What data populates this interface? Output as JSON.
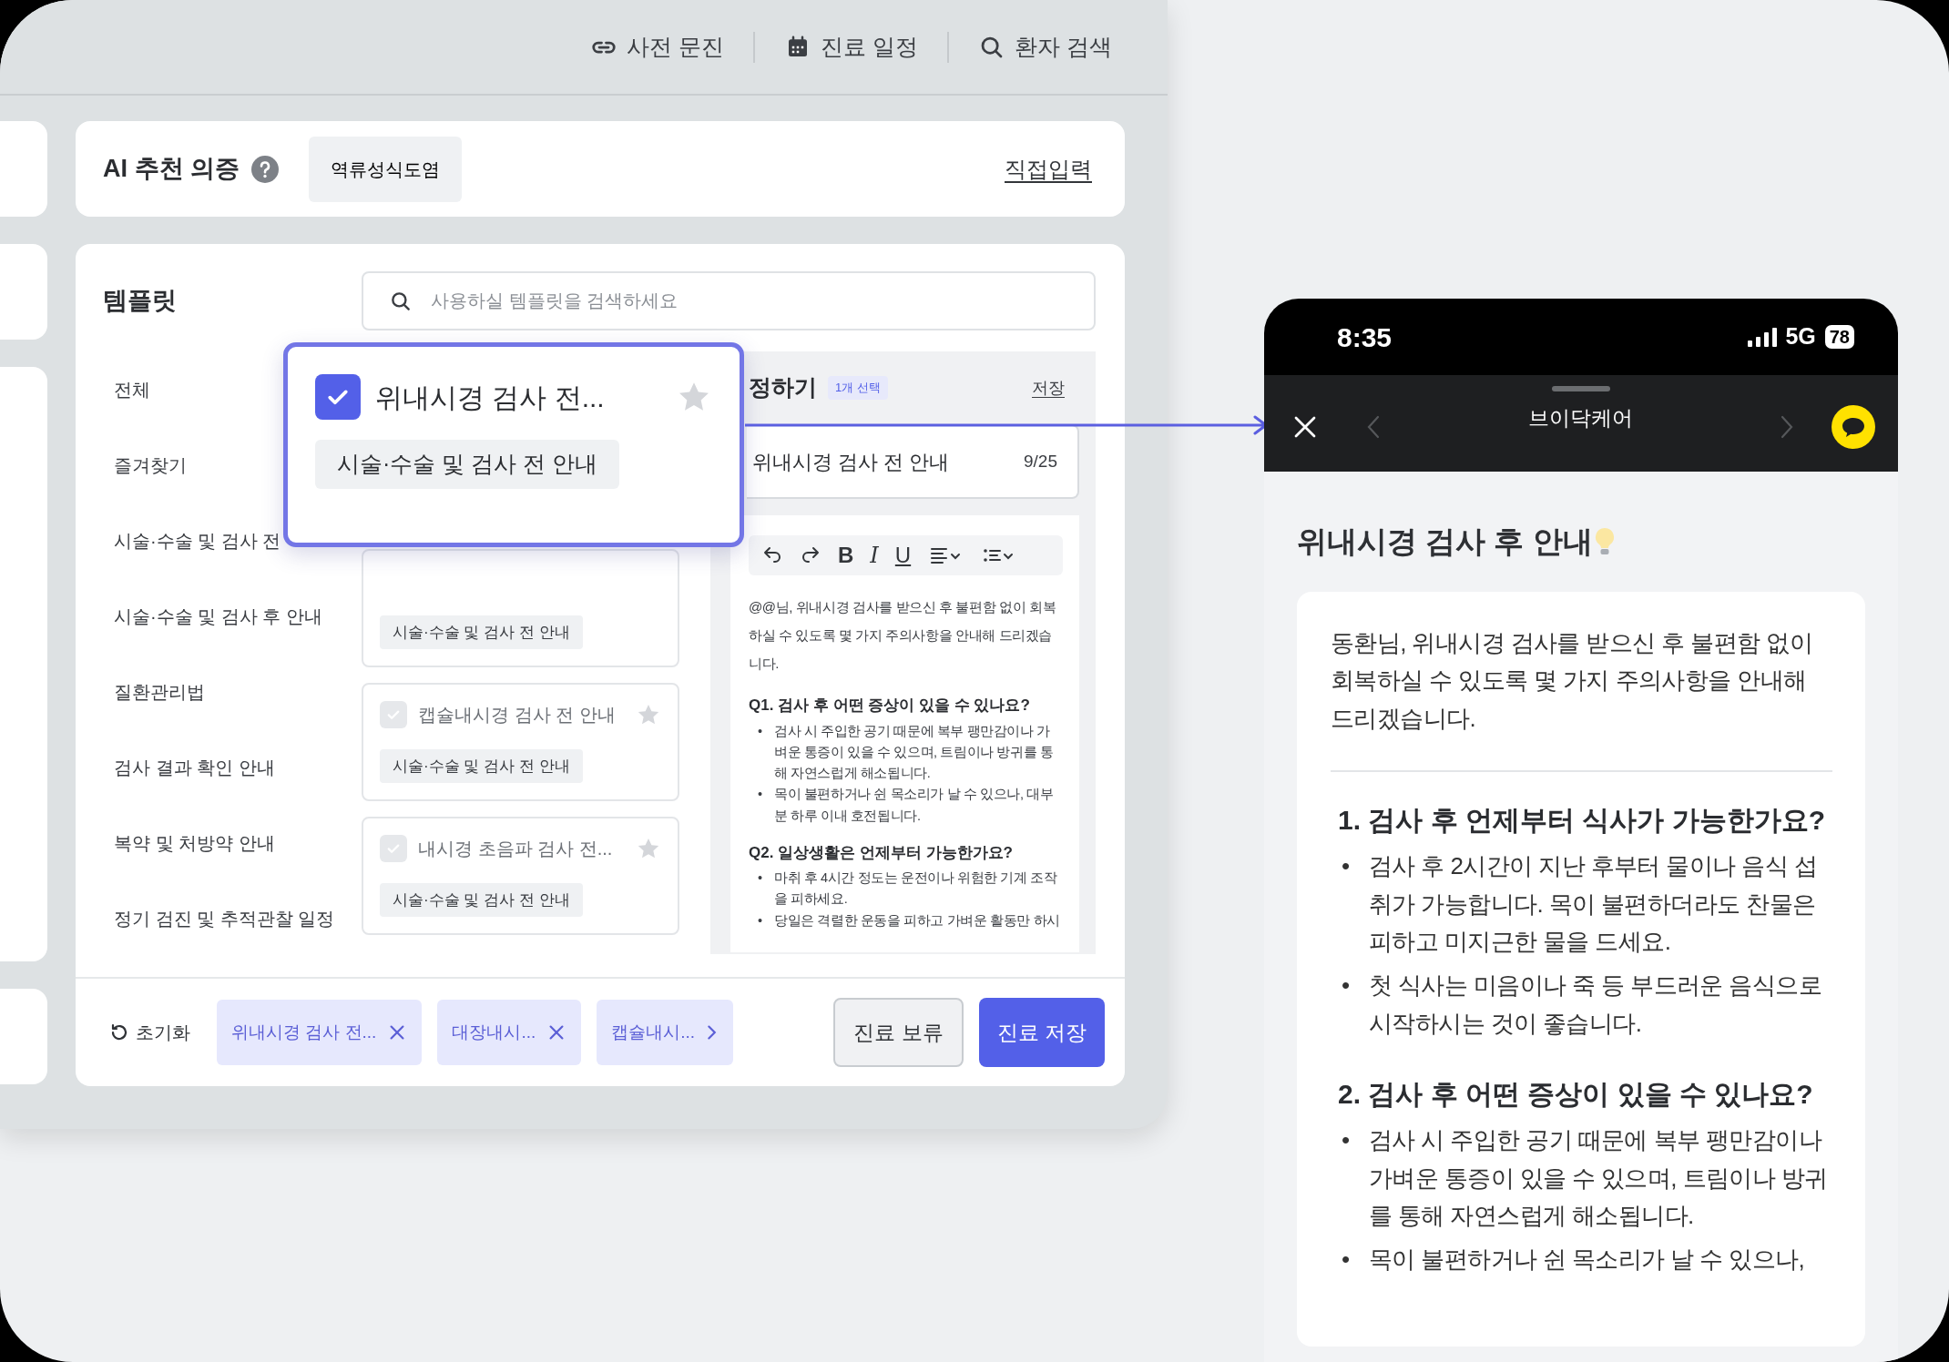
{
  "top_nav": [
    {
      "kind": "link",
      "label": "사전 문진"
    },
    {
      "kind": "calendar",
      "label": "진료 일정"
    },
    {
      "kind": "search",
      "label": "환자 검색"
    }
  ],
  "ai_diagnosis": {
    "title": "AI 추천 의증",
    "suggestions": [
      "역류성식도염"
    ],
    "manual_input": "직접입력"
  },
  "templates": {
    "title": "템플릿",
    "search": {
      "placeholder": "사용하실 템플릿을 검색하세요"
    },
    "categories": [
      "전체",
      "즐겨찾기",
      "시술·수술 및 검사 전",
      "시술·수술 및 검사 후 안내",
      "질환관리법",
      "검사 결과 확인 안내",
      "복약 및 처방약 안내",
      "정기 검진 및 추적관찰 일정"
    ],
    "items": [
      {
        "tag": "시술·수술 및 검사 전 안내"
      },
      {
        "title": "캡슐내시경 검사 전 안내",
        "checked": false,
        "starred": false,
        "tag": "시술·수술 및 검사 전 안내"
      },
      {
        "title": "내시경 초음파 검사 전...",
        "checked": false,
        "starred": false,
        "tag": "시술·수술 및 검사 전 안내"
      }
    ],
    "highlight": {
      "title": "위내시경 검사 전...",
      "checked": true,
      "starred": false,
      "tag": "시술·수술 및 검사 전 안내"
    }
  },
  "editor": {
    "heading": "정하기",
    "badge": "1개 선택",
    "save": "저장",
    "title_field": {
      "value": "위내시경 검사 전 안내",
      "counter": "9/25"
    },
    "toolbar": [
      {
        "kind": "undo"
      },
      {
        "kind": "redo"
      },
      {
        "kind": "bold",
        "label": "B"
      },
      {
        "kind": "italic",
        "label": "I"
      },
      {
        "kind": "underline",
        "label": "U"
      },
      {
        "kind": "align"
      },
      {
        "kind": "list"
      }
    ],
    "body": [
      {
        "kind": "paragraph",
        "text": "@@님, 위내시경 검사를 받으신 후 불편함 없이 회복하실 수 있도록 몇 가지 주의사항을 안내해 드리겠습니다."
      },
      {
        "kind": "heading",
        "text": "Q1. 검사 후 어떤 증상이 있을 수 있나요?"
      },
      {
        "kind": "bullets",
        "marker": "•",
        "items": [
          "검사 시 주입한 공기 때문에 복부 팽만감이나 가벼운 통증이 있을 수 있으며, 트림이나 방귀를 통해 자연스럽게 해소됩니다.",
          "목이 불편하거나 쉰 목소리가 날 수 있으나, 대부분 하루 이내 호전됩니다."
        ]
      },
      {
        "kind": "heading",
        "text": "Q2. 일상생활은 언제부터 가능한가요?"
      },
      {
        "kind": "bullets",
        "marker": "•",
        "items": [
          "마취 후 4시간 정도는 운전이나 위험한 기계 조작을 피하세요.",
          "당일은 격렬한 운동을 피하고 가벼운 활동만 하시"
        ]
      }
    ]
  },
  "bottom_bar": {
    "reset": "초기화",
    "chips": [
      {
        "kind": "removable",
        "label": "위내시경 검사 전..."
      },
      {
        "kind": "removable",
        "label": "대장내시..."
      },
      {
        "kind": "more",
        "label": "캡슐내시..."
      }
    ],
    "hold": "진료 보류",
    "save": "진료 저장"
  },
  "phone": {
    "time": "8:35",
    "network": "5G",
    "battery": "78",
    "title": "브이닥케어",
    "message_title": "위내시경 검사 후 안내",
    "intro": "동환님, 위내시경 검사를 받으신 후 불편함 없이 회복하실 수 있도록 몇 가지 주의사항을 안내해 드리겠습니다.",
    "sections": [
      {
        "heading": "1. 검사 후 언제부터 식사가 가능한가요?",
        "marker": "•",
        "bullets": [
          "검사 후 2시간이 지난 후부터 물이나 음식 섭취가 가능합니다. 목이 불편하더라도 찬물은 피하고 미지근한 물을 드세요.",
          "첫 식사는 미음이나 죽 등 부드러운 음식으로 시작하시는 것이 좋습니다."
        ]
      },
      {
        "heading": "2. 검사 후 어떤 증상이 있을 수 있나요?",
        "marker": "•",
        "bullets": [
          "검사 시 주입한 공기 때문에 복부 팽만감이나 가벼운 통증이 있을 수 있으며, 트림이나 방귀를 통해 자연스럽게 해소됩니다.",
          "목이 불편하거나 쉰 목소리가 날 수 있으나,"
        ]
      }
    ]
  }
}
